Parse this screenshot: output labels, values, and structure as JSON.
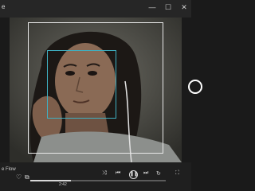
{
  "titlebar": {
    "title": "e",
    "minimize": "—",
    "maximize": "☐",
    "close": "✕"
  },
  "caption": "e Flow",
  "icons": {
    "heart": "♡",
    "frame": "⧉",
    "shuffle": "⤨",
    "previous": "⏮",
    "pause": "❚❚",
    "next": "⏭",
    "repeat": "↻",
    "fullscreen": "⛶"
  },
  "playback": {
    "time_current": "2:42",
    "progress": 0.3
  },
  "colors": {
    "face_box_outer": "#e8e8e8",
    "face_box_inner": "#3fb0c2"
  }
}
